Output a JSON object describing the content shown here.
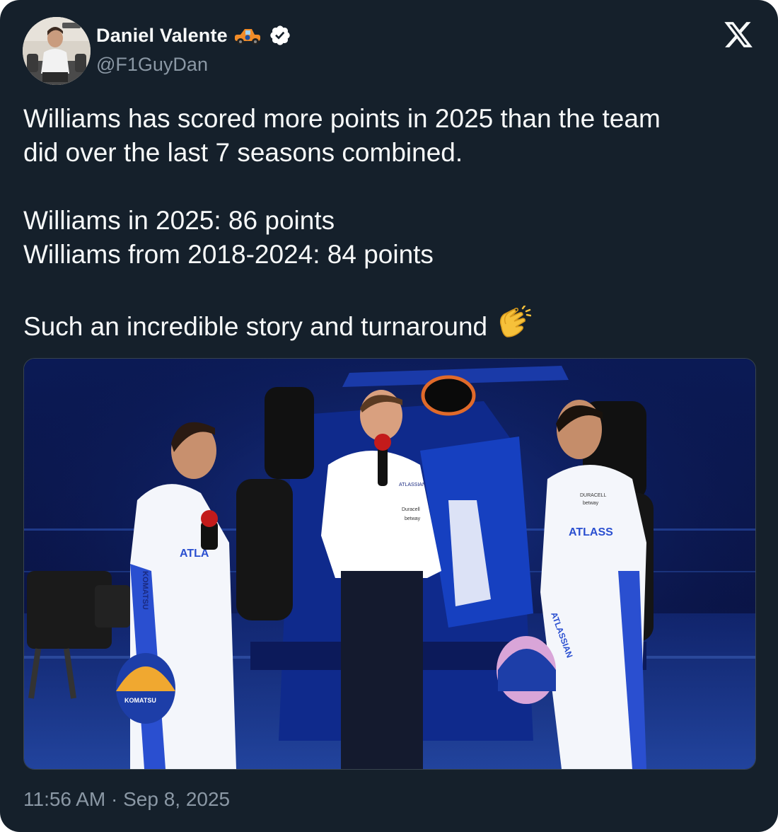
{
  "author": {
    "display_name": "Daniel Valente",
    "handle": "@F1GuyDan",
    "avatar_icon": "profile-photo",
    "name_emoji": "race-car-emoji",
    "verified_icon": "verified-badge-icon"
  },
  "brand_icon": "x-logo-icon",
  "tweet": {
    "line1": "Williams has scored more points in 2025 than the team",
    "line2": "did over the last 7 seasons combined.",
    "line3": "Williams in 2025: 86 points",
    "line4": "Williams from 2018-2024: 84 points",
    "line5": "Such an incredible story and turnaround",
    "line5_emoji": "clapping-hands-emoji"
  },
  "media": {
    "image_icon": "williams-racing-launch-photo",
    "visible_text": [
      "ATLASSIAN",
      "KOMATSU",
      "Duracell",
      "betway"
    ]
  },
  "timestamp": "11:56 AM · Sep 8, 2025",
  "colors": {
    "background": "#15202b",
    "text_primary": "#f7f9f9",
    "text_secondary": "#8b98a5",
    "border": "#38444d"
  }
}
